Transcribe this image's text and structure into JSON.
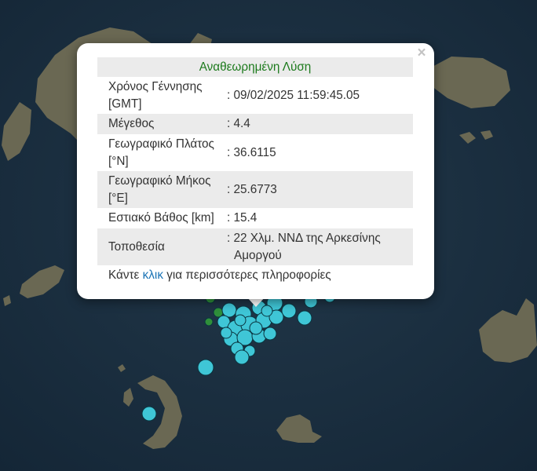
{
  "popup": {
    "title": "Αναθεωρημένη Λύση",
    "close_glyph": "×",
    "rows": [
      {
        "label": "Χρόνος Γέννησης",
        "label2": "[GMT]",
        "value": ": 09/02/2025 11:59:45.05"
      },
      {
        "label": "Μέγεθος",
        "value": ": 4.4"
      },
      {
        "label": "Γεωγραφικό Πλάτος",
        "label2": "[°N]",
        "value": ": 36.6115"
      },
      {
        "label": "Γεωγραφικό Μήκος",
        "label2": "[°E]",
        "value": ": 25.6773"
      },
      {
        "label": "Εστιακό Βάθος [km]",
        "value": ": 15.4"
      },
      {
        "label": "Τοποθεσία",
        "value": ": 22 Χλμ. ΝΝΔ της Αρκεσίνης",
        "value2": "Αμοργού"
      }
    ],
    "more_prefix": "Κάντε ",
    "more_link": "κλικ",
    "more_suffix": " για περισσότερες πληροφορίες"
  },
  "map_colors": {
    "sea": "#1c3040",
    "land": "#6b6a55",
    "marker_cyan": "#3fc6d6",
    "marker_green": "#2f8f3a",
    "marker_stroke": "#0a3540"
  }
}
